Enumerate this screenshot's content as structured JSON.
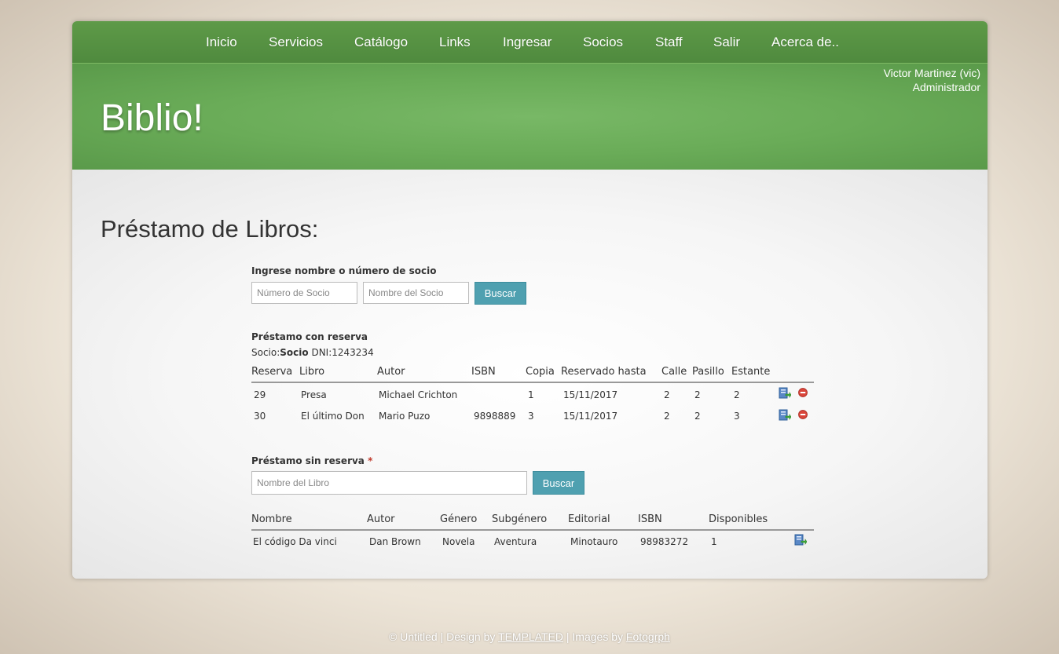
{
  "nav": {
    "items": [
      {
        "label": "Inicio"
      },
      {
        "label": "Servicios"
      },
      {
        "label": "Catálogo"
      },
      {
        "label": "Links"
      },
      {
        "label": "Ingresar"
      },
      {
        "label": "Socios"
      },
      {
        "label": "Staff"
      },
      {
        "label": "Salir"
      },
      {
        "label": "Acerca de.."
      }
    ]
  },
  "header": {
    "site_title": "Biblio!",
    "user_name": "Victor Martinez (vic)",
    "user_role": "Administrador"
  },
  "main": {
    "page_title": "Préstamo de Libros:",
    "search_member": {
      "label": "Ingrese nombre o número de socio",
      "number_placeholder": "Número de Socio",
      "name_placeholder": "Nombre del Socio",
      "button": "Buscar"
    },
    "reserved_loan": {
      "title": "Préstamo con reserva",
      "socio_prefix": "Socio:",
      "socio_name": "Socio",
      "socio_dni": " DNI:1243234",
      "headers": [
        "Reserva",
        "Libro",
        "Autor",
        "ISBN",
        "Copia",
        "Reservado hasta",
        "Calle",
        "Pasillo",
        "Estante"
      ],
      "rows": [
        [
          "29",
          "Presa",
          "Michael Crichton",
          "",
          "1",
          "15/11/2017",
          "2",
          "2",
          "2"
        ],
        [
          "30",
          "El último Don",
          "Mario Puzo",
          "9898889",
          "3",
          "15/11/2017",
          "2",
          "2",
          "3"
        ]
      ],
      "row_actions": [
        "lend-icon",
        "remove-icon"
      ]
    },
    "unreserved_loan": {
      "title": "Préstamo sin reserva",
      "required_mark": "*",
      "book_placeholder": "Nombre del Libro",
      "button": "Buscar",
      "headers": [
        "Nombre",
        "Autor",
        "Género",
        "Subgénero",
        "Editorial",
        "ISBN",
        "Disponibles"
      ],
      "rows": [
        [
          "El código Da vinci",
          "Dan Brown",
          "Novela",
          "Aventura",
          "Minotauro",
          "98983272",
          "1"
        ]
      ],
      "row_actions": [
        "lend-icon"
      ]
    }
  },
  "footer": {
    "prefix": "© Untitled | Design by ",
    "link1": "TEMPLATED",
    "middle": " | Images by ",
    "link2": "Fotogrph"
  },
  "colors": {
    "nav_green": "#4f8a3e",
    "header_green": "#6aac58",
    "button_teal": "#4fa0b0",
    "remove_red": "#d9453a"
  }
}
